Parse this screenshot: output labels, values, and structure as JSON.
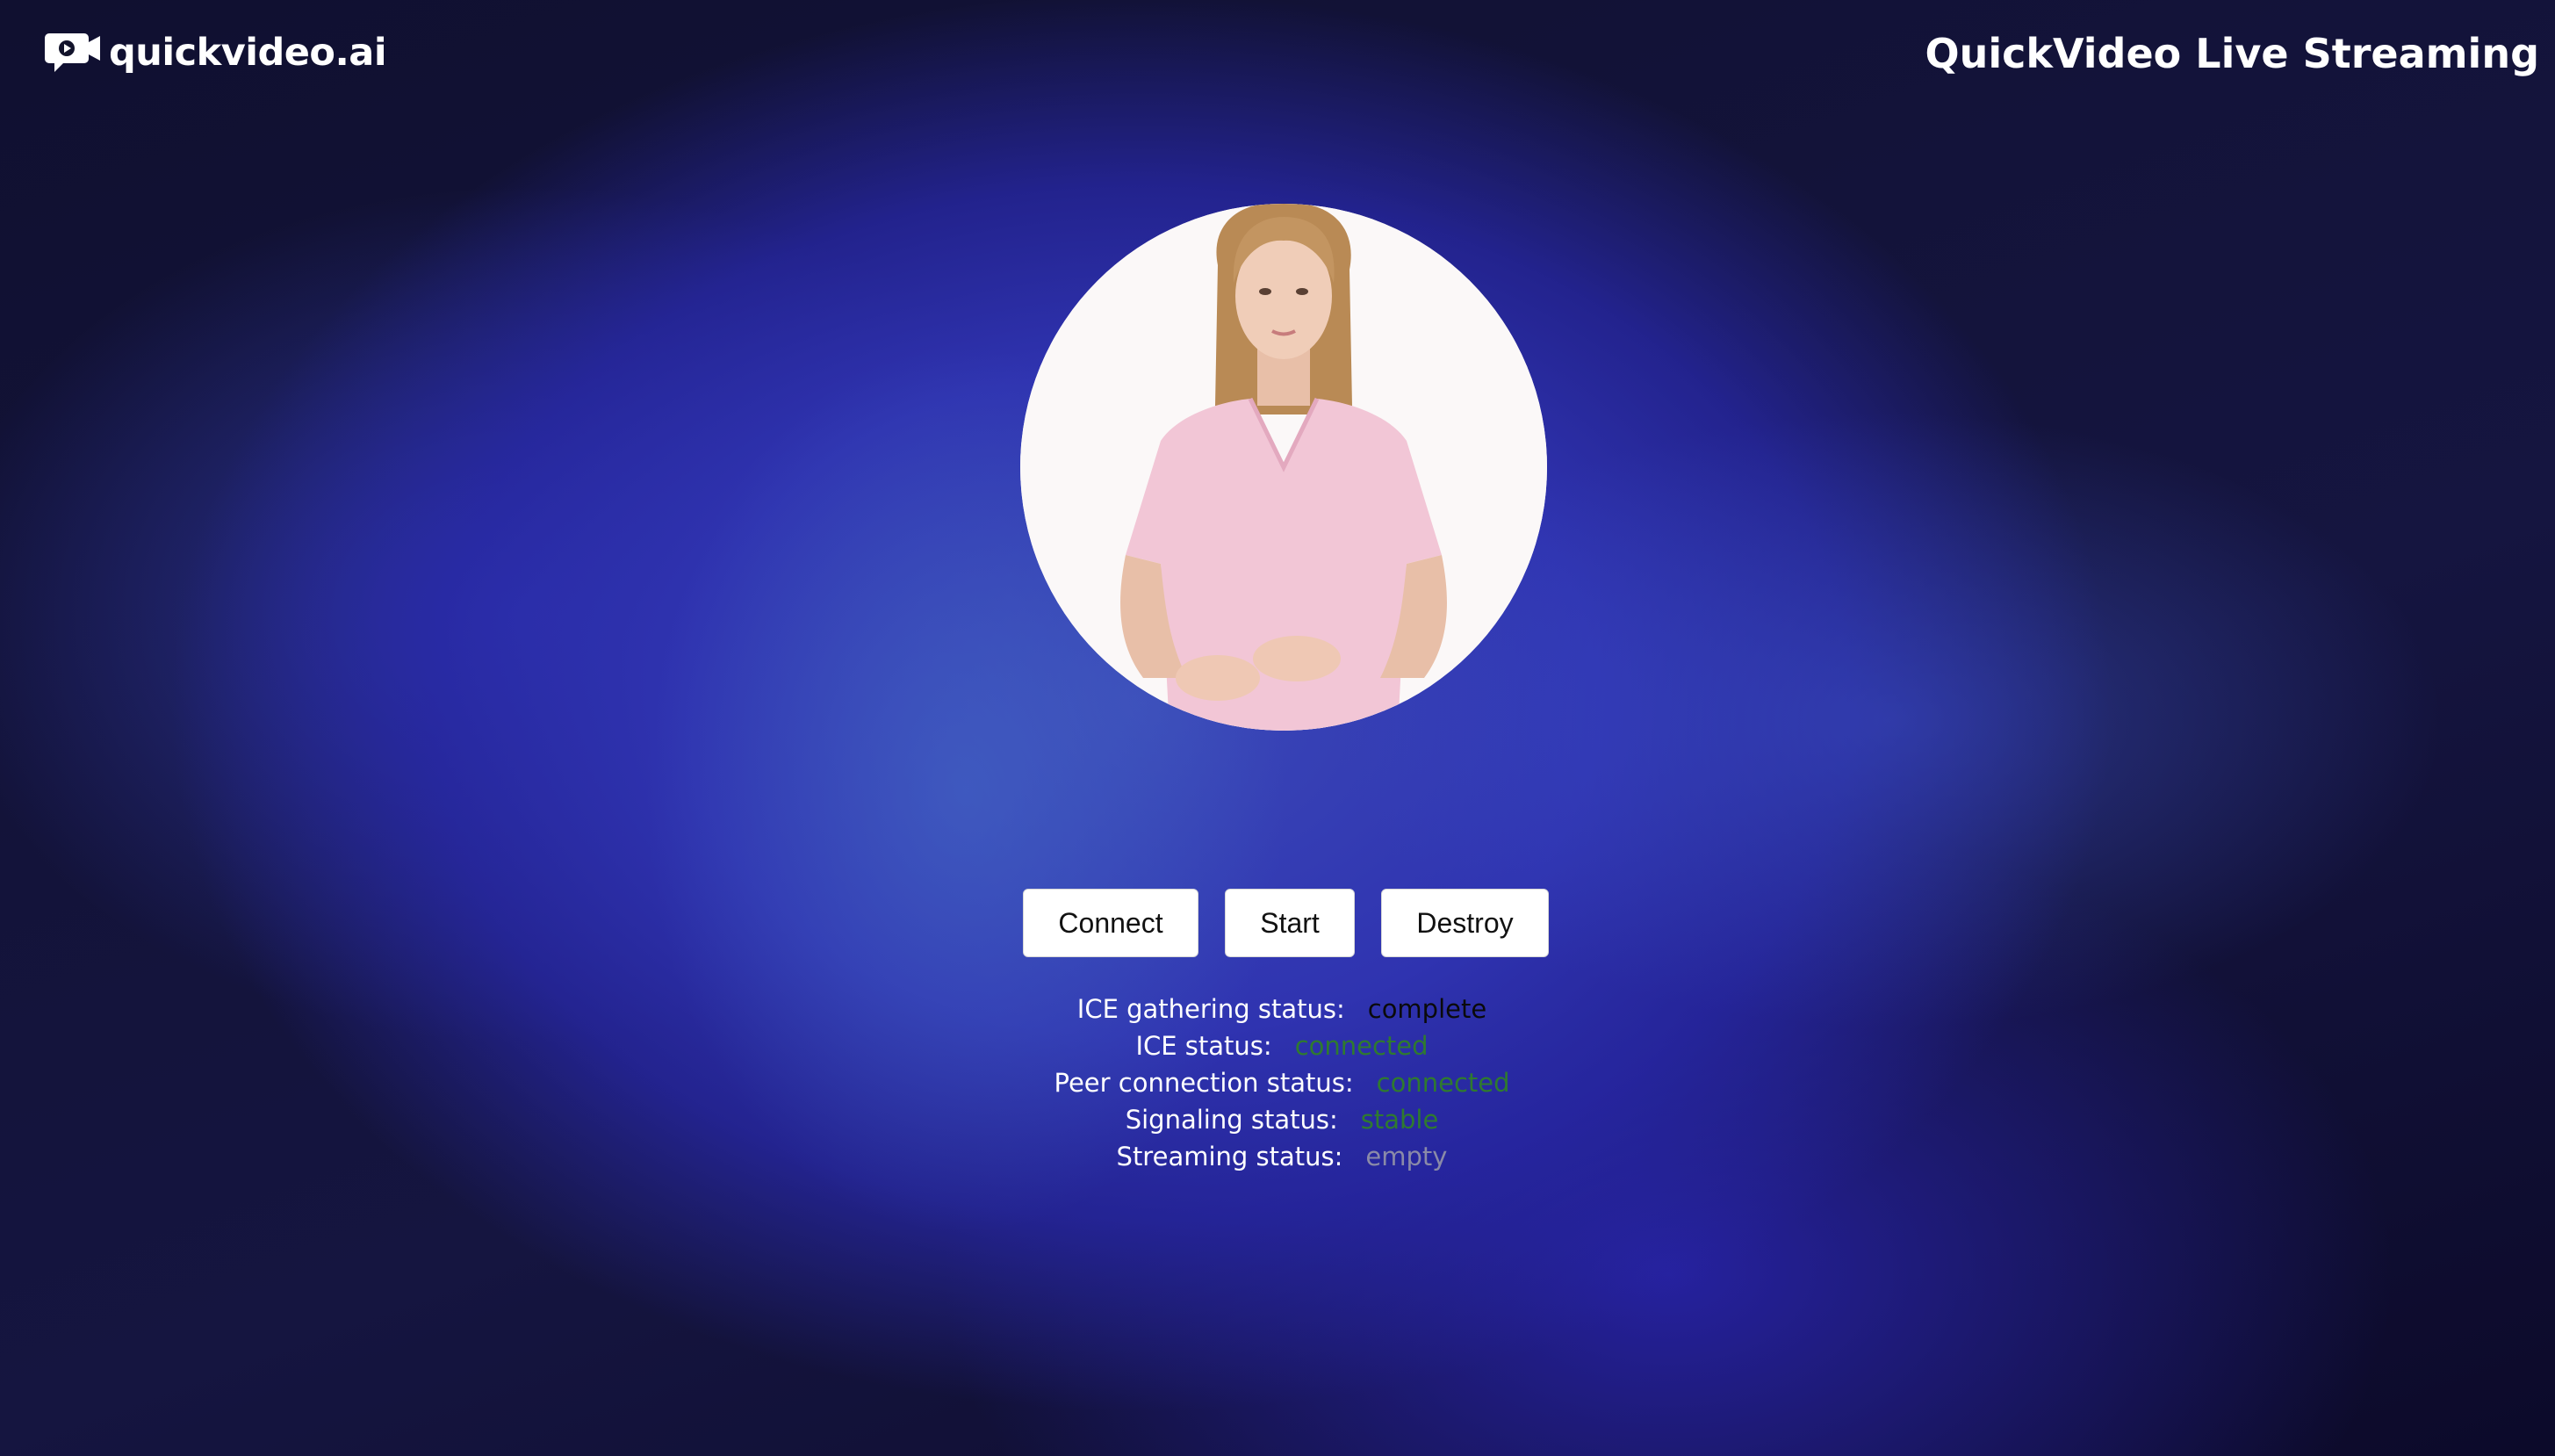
{
  "header": {
    "logo_text": "quickvideo.ai",
    "logo_icon": "video-camera-chat-icon",
    "app_title": "QuickVideo Live Streaming"
  },
  "video": {
    "subject": "avatar-presenter-image"
  },
  "controls": {
    "connect_label": "Connect",
    "start_label": "Start",
    "destroy_label": "Destroy"
  },
  "status": {
    "ice_gathering": {
      "label": "ICE gathering status:",
      "value": "complete",
      "color": "#0a0a0a"
    },
    "ice": {
      "label": "ICE status:",
      "value": "connected",
      "color": "#2f7a2f"
    },
    "peer_connection": {
      "label": "Peer connection status:",
      "value": "connected",
      "color": "#2f7a2f"
    },
    "signaling": {
      "label": "Signaling status:",
      "value": "stable",
      "color": "#2f7a2f"
    },
    "streaming": {
      "label": "Streaming status:",
      "value": "empty",
      "color": "#8a8aa8"
    }
  }
}
